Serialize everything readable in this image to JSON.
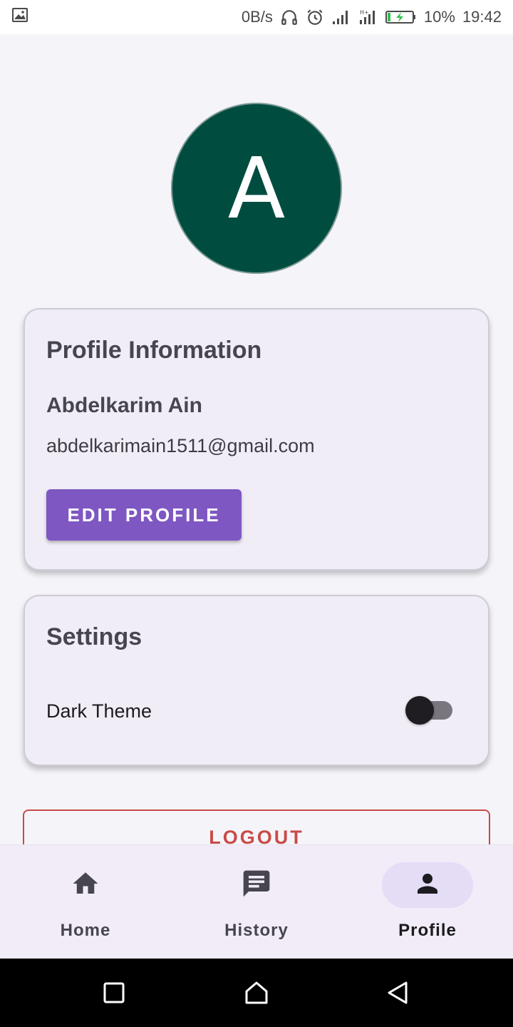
{
  "status_bar": {
    "net_speed": "0B/s",
    "battery": "10%",
    "time": "19:42"
  },
  "avatar": {
    "initial": "A",
    "color": "#004d40"
  },
  "profile_card": {
    "title": "Profile Information",
    "name": "Abdelkarim Ain",
    "email": "abdelkarimain1511@gmail.com",
    "edit_label": "EDIT PROFILE"
  },
  "settings_card": {
    "title": "Settings",
    "dark_theme_label": "Dark Theme",
    "dark_theme_enabled": false
  },
  "logout_label": "LOGOUT",
  "bottom_nav": {
    "items": [
      {
        "label": "Home",
        "icon": "home-icon"
      },
      {
        "label": "History",
        "icon": "chat-history-icon"
      },
      {
        "label": "Profile",
        "icon": "person-icon",
        "active": true
      }
    ]
  },
  "colors": {
    "accent": "#7e57c2",
    "danger": "#c94a47",
    "card_bg": "#f0edf7"
  }
}
